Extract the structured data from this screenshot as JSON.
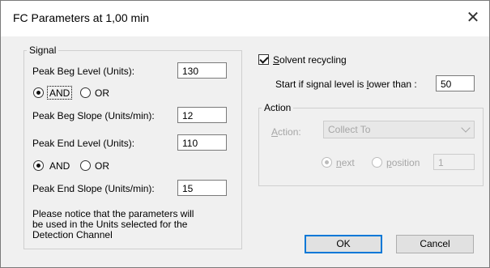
{
  "window": {
    "title": "FC Parameters at 1,00 min",
    "close_glyph": "✕"
  },
  "signal": {
    "legend": "Signal",
    "peak_beg_level_label": "Peak Beg Level (Units):",
    "peak_beg_level_value": "130",
    "and_label": "AND",
    "or_label": "OR",
    "logic1_selected": "AND",
    "peak_beg_slope_label": "Peak Beg Slope (Units/min):",
    "peak_beg_slope_value": "12",
    "peak_end_level_label": "Peak End Level (Units):",
    "peak_end_level_value": "110",
    "logic2_selected": "AND",
    "peak_end_slope_label": "Peak End Slope (Units/min):",
    "peak_end_slope_value": "15",
    "notice_line1": "Please notice that the parameters will",
    "notice_line2": "be used in the Units selected for the",
    "notice_line3": "Detection Channel"
  },
  "recycling": {
    "checkbox_label_first": "S",
    "checkbox_label_rest": "olvent recycling",
    "checked": true,
    "start_label_a": "Start if signal level is ",
    "start_label_u": "l",
    "start_label_b": "ower than :",
    "start_value": "50"
  },
  "action": {
    "legend": "Action",
    "action_label_u": "A",
    "action_label_rest": "ction:",
    "action_value": "Collect To",
    "next_label_u": "n",
    "next_label_rest": "ext",
    "position_label_u": "p",
    "position_label_rest": "osition",
    "position_value": "1",
    "next_selected": true
  },
  "buttons": {
    "ok": "OK",
    "cancel": "Cancel"
  }
}
